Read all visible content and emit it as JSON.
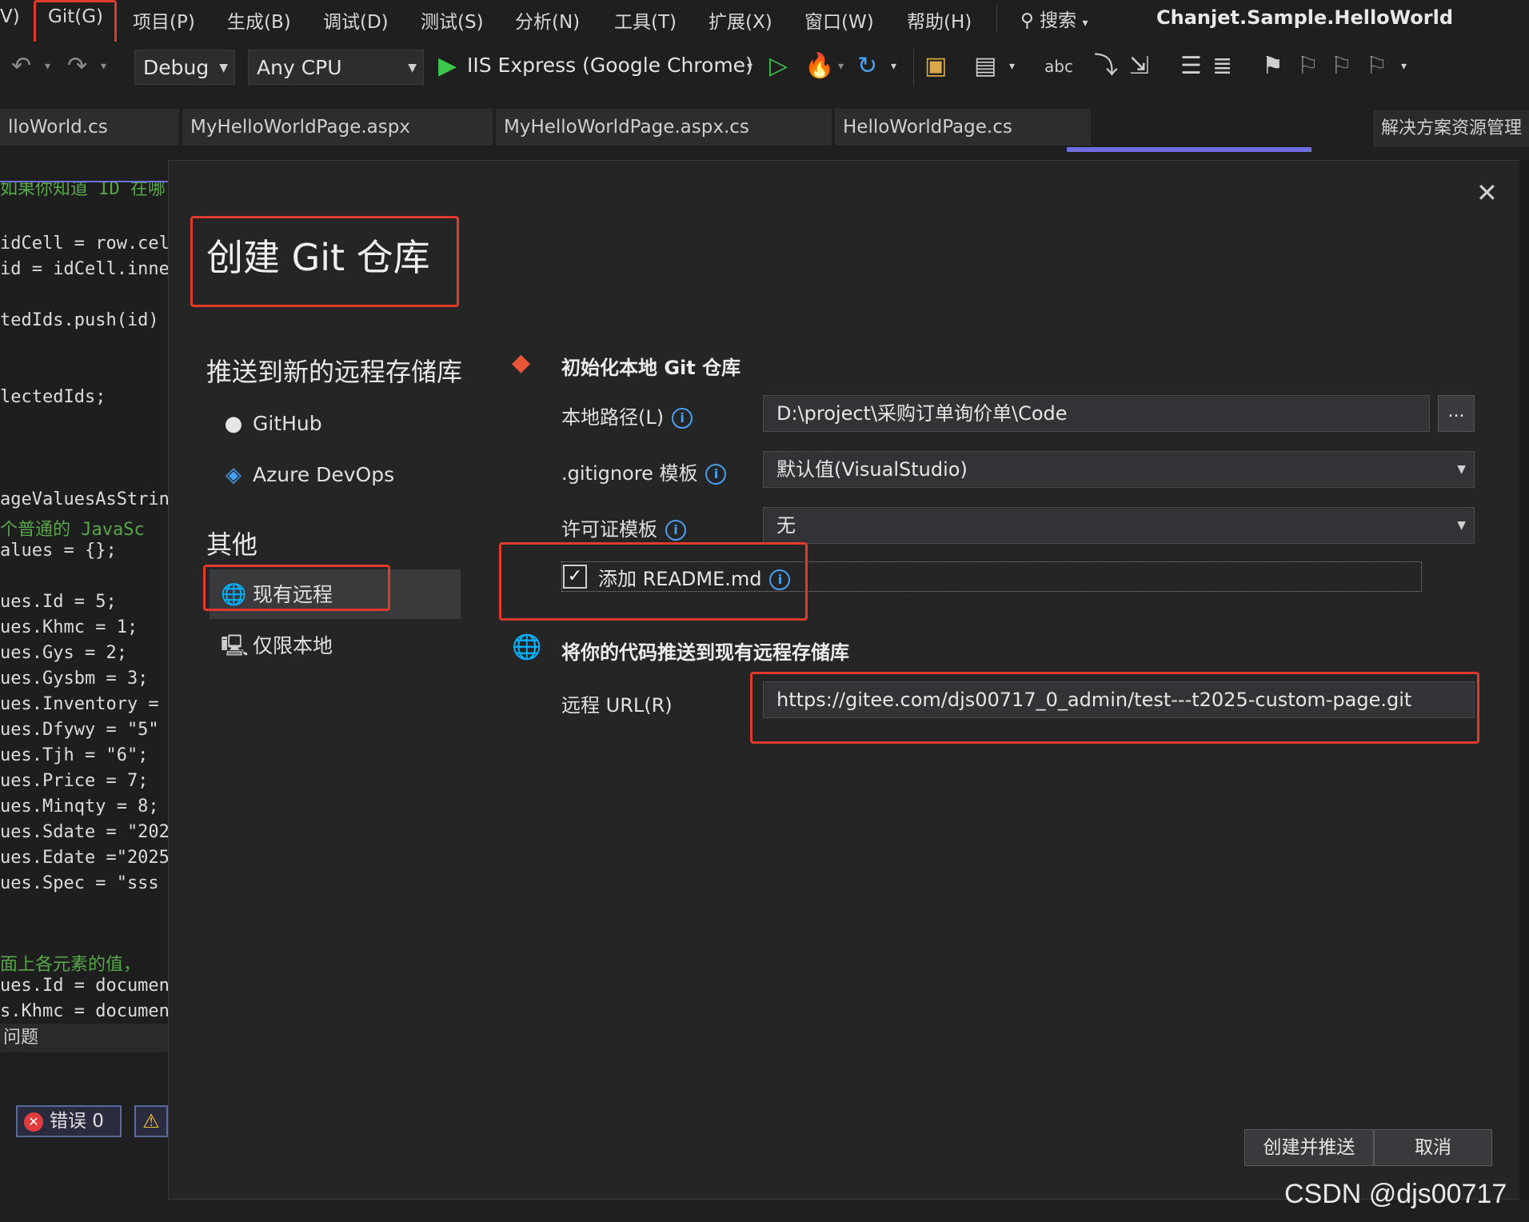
{
  "menubar": {
    "partial_left": "V)",
    "items": [
      "Git(G)",
      "项目(P)",
      "生成(B)",
      "调试(D)",
      "测试(S)",
      "分析(N)",
      "工具(T)",
      "扩展(X)",
      "窗口(W)",
      "帮助(H)"
    ],
    "search": "搜索",
    "solution_title": "Chanjet.Sample.HelloWorld"
  },
  "toolbar": {
    "config": "Debug",
    "platform": "Any CPU",
    "run_target": "IIS Express (Google Chrome)"
  },
  "tabs": [
    "lloWorld.cs",
    "MyHelloWorldPage.aspx",
    "MyHelloWorldPage.aspx.cs",
    "HelloWorldPage.cs"
  ],
  "right_panel_tab": "解决方案资源管理",
  "editor": {
    "lines": [
      {
        "text": "如果你知道 ID 在哪",
        "comment": true
      },
      {
        "text": "idCell = row.cel",
        "comment": false
      },
      {
        "text": "id = idCell.inne",
        "comment": false
      },
      {
        "text": "tedIds.push(id)",
        "comment": false
      },
      {
        "text": "lectedIds;",
        "comment": false
      },
      {
        "text": "ageValuesAsStrin",
        "comment": false
      },
      {
        "text": "个普通的 JavaSc",
        "comment": true
      },
      {
        "text": "alues = {};",
        "comment": false
      },
      {
        "text": "ues.Id = 5;",
        "comment": false
      },
      {
        "text": "ues.Khmc = 1;",
        "comment": false
      },
      {
        "text": "ues.Gys = 2;",
        "comment": false
      },
      {
        "text": "ues.Gysbm = 3;",
        "comment": false
      },
      {
        "text": "ues.Inventory =",
        "comment": false
      },
      {
        "text": "ues.Dfywy = \"5\"",
        "comment": false
      },
      {
        "text": "ues.Tjh = \"6\";",
        "comment": false
      },
      {
        "text": "ues.Price = 7;",
        "comment": false
      },
      {
        "text": "ues.Minqty = 8;",
        "comment": false
      },
      {
        "text": "ues.Sdate = \"202",
        "comment": false
      },
      {
        "text": "ues.Edate =\"2025",
        "comment": false
      },
      {
        "text": "ues.Spec = \"sss",
        "comment": false
      },
      {
        "text": "面上各元素的值，",
        "comment": true
      },
      {
        "text": "ues.Id = documen",
        "comment": false
      },
      {
        "text": "s.Khmc = documen",
        "comment": false
      }
    ],
    "problems_label": "问题",
    "errors_label": "错误 0"
  },
  "dialog": {
    "title": "创建 Git 仓库",
    "sidebar": {
      "push_new_heading": "推送到新的远程存储库",
      "github": "GitHub",
      "azure": "Azure DevOps",
      "other_heading": "其他",
      "existing_remote": "现有远程",
      "local_only": "仅限本地"
    },
    "init_section": {
      "heading": "初始化本地 Git 仓库",
      "local_path_label": "本地路径(L)",
      "local_path_value": "D:\\project\\采购订单询价单\\Code",
      "browse": "...",
      "gitignore_label": ".gitignore 模板",
      "gitignore_value": "默认值(VisualStudio)",
      "license_label": "许可证模板",
      "license_value": "无",
      "readme_label": "添加 README.md",
      "readme_checked": true
    },
    "push_section": {
      "heading": "将你的代码推送到现有远程存储库",
      "remote_url_label": "远程 URL(R)",
      "remote_url_value": "https://gitee.com/djs00717_0_admin/test---t2025-custom-page.git"
    },
    "buttons": {
      "create_push": "创建并推送",
      "cancel": "取消"
    }
  },
  "watermark": "CSDN @djs00717",
  "colors": {
    "highlight": "#e03a2c",
    "accent_blue": "#4aa0f0",
    "run_green": "#3cc84a"
  }
}
